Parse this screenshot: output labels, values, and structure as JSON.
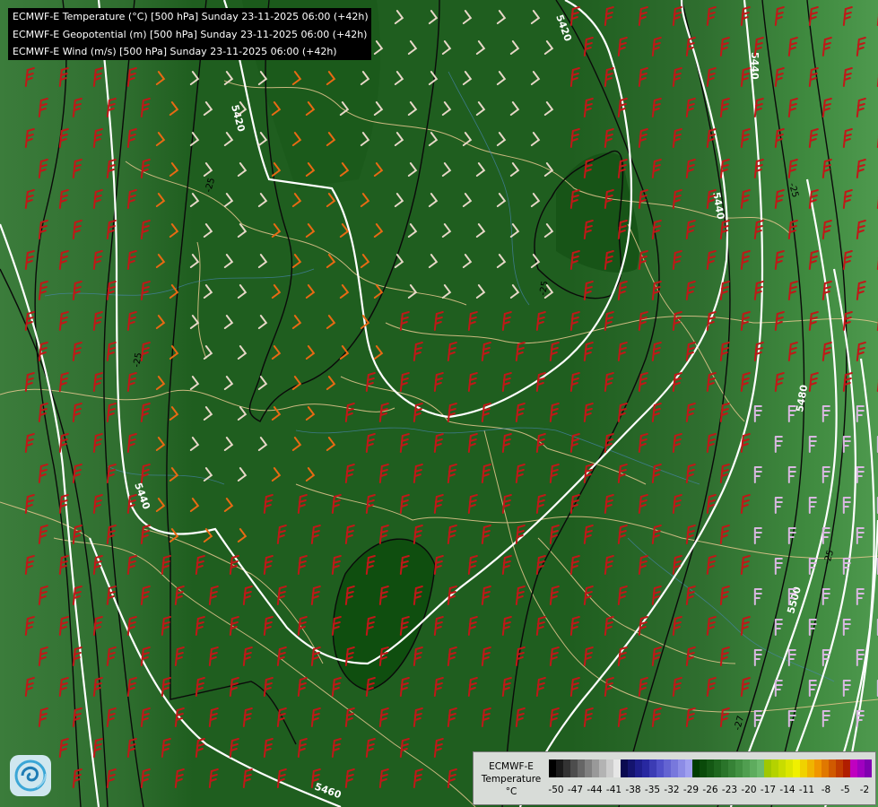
{
  "header": {
    "lines": [
      "ECMWF-E Temperature (°C) [500 hPa] Sunday 23-11-2025 06:00 (+42h)",
      "ECMWF-E Geopotential (m) [500 hPa] Sunday 23-11-2025 06:00 (+42h)",
      "ECMWF-E Wind (m/s) [500 hPa] Sunday 23-11-2025 06:00 (+42h)"
    ]
  },
  "legend": {
    "title": [
      "ECMWF-E",
      "Temperature",
      "°C"
    ],
    "tick_labels": [
      "-50",
      "-47",
      "-44",
      "-41",
      "-38",
      "-35",
      "-32",
      "-29",
      "-26",
      "-23",
      "-20",
      "-17",
      "-14",
      "-11",
      "-8",
      "-5",
      "-2"
    ],
    "colors": [
      "#000000",
      "#1a1a1a",
      "#333333",
      "#4d4d4d",
      "#666666",
      "#808080",
      "#999999",
      "#b3b3b3",
      "#cccccc",
      "#e6e6e6",
      "#0a0a50",
      "#14146e",
      "#1e1e8c",
      "#2828a0",
      "#3c3cb4",
      "#5050c8",
      "#6464d2",
      "#7878dc",
      "#8c8ce6",
      "#a0a0f0",
      "#003c00",
      "#0a4a0a",
      "#145814",
      "#1e661e",
      "#2a742a",
      "#368236",
      "#429042",
      "#509e50",
      "#5eac5e",
      "#6cba6c",
      "#a0c800",
      "#b4d200",
      "#c8dc00",
      "#dce600",
      "#f0f000",
      "#f0d200",
      "#f0b400",
      "#f09600",
      "#e07800",
      "#d05a00",
      "#c03c00",
      "#b01e00",
      "#c000c0",
      "#a000c0",
      "#8000b0"
    ]
  },
  "contour_labels": {
    "geopotential": [
      "5420",
      "5440",
      "5440",
      "5440",
      "5480",
      "5500",
      "5460",
      "5420"
    ],
    "temperature": [
      "-25",
      "-25",
      "-25",
      "-25",
      "-27",
      "-25"
    ]
  },
  "colors": {
    "background_main": "#1f5e1f",
    "wind_red": "#c01818",
    "wind_orange": "#e86a14",
    "wind_light": "#e8d8c8",
    "wind_lilac": "#d8b8e0",
    "border": "#e8c890"
  },
  "logo_icon": "ecmwf-swirl-icon"
}
